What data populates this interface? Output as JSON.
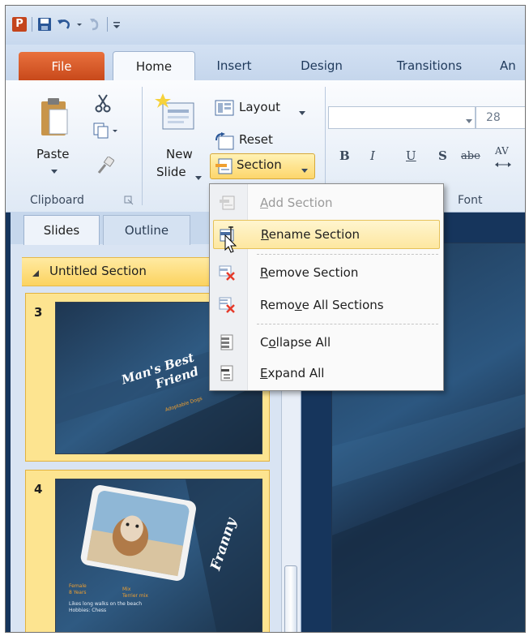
{
  "qat": {
    "app_icon": "P"
  },
  "tabs": {
    "file": "File",
    "home": "Home",
    "insert": "Insert",
    "design": "Design",
    "transitions": "Transitions",
    "animations_partial": "An"
  },
  "ribbon": {
    "clipboard": {
      "paste": "Paste",
      "group_label": "Clipboard"
    },
    "slides": {
      "new_slide_line1": "New",
      "new_slide_line2": "Slide",
      "layout": "Layout",
      "reset": "Reset",
      "section": "Section"
    },
    "font": {
      "font_name": "",
      "font_size": "28",
      "bold": "B",
      "italic": "I",
      "underline": "U",
      "shadow": "S",
      "strikethrough": "abe",
      "spacing": "AV",
      "group_label": "Font"
    }
  },
  "pane": {
    "tab_slides": "Slides",
    "tab_outline": "Outline",
    "section_name": "Untitled Section",
    "slides": [
      {
        "number": "3",
        "title_line1": "Man's Best",
        "title_line2": "Friend",
        "subtitle": "Adoptable Dogs"
      },
      {
        "number": "4",
        "title": "Franny",
        "caption_left1": "Female",
        "caption_left2": "8 Years",
        "caption_right1": "Mix",
        "caption_right2": "Terrier mix",
        "body1": "Likes long walks on the beach",
        "body2": "Hobbies: Chess"
      }
    ]
  },
  "section_menu": {
    "items": [
      {
        "prefix": "",
        "key": "A",
        "rest": "dd Section",
        "state": "disabled",
        "icon": "add-section-icon"
      },
      {
        "prefix": "",
        "key": "R",
        "rest": "ename Section",
        "state": "hover",
        "icon": "rename-section-icon"
      },
      {
        "prefix": "",
        "key": "R",
        "rest": "emove Section",
        "state": "normal",
        "icon": "remove-section-icon"
      },
      {
        "prefix": "Remo",
        "key": "v",
        "rest": "e All Sections",
        "state": "normal",
        "icon": "remove-all-sections-icon"
      },
      {
        "prefix": "C",
        "key": "o",
        "rest": "llapse All",
        "state": "normal",
        "icon": "collapse-all-icon"
      },
      {
        "prefix": "",
        "key": "E",
        "rest": "xpand All",
        "state": "normal",
        "icon": "expand-all-icon"
      }
    ]
  },
  "colors": {
    "file_tab": "#d9571f",
    "section_highlight": "#fdd66b",
    "slide_bg": "#1f3a57",
    "accent_orange": "#f0a030"
  }
}
